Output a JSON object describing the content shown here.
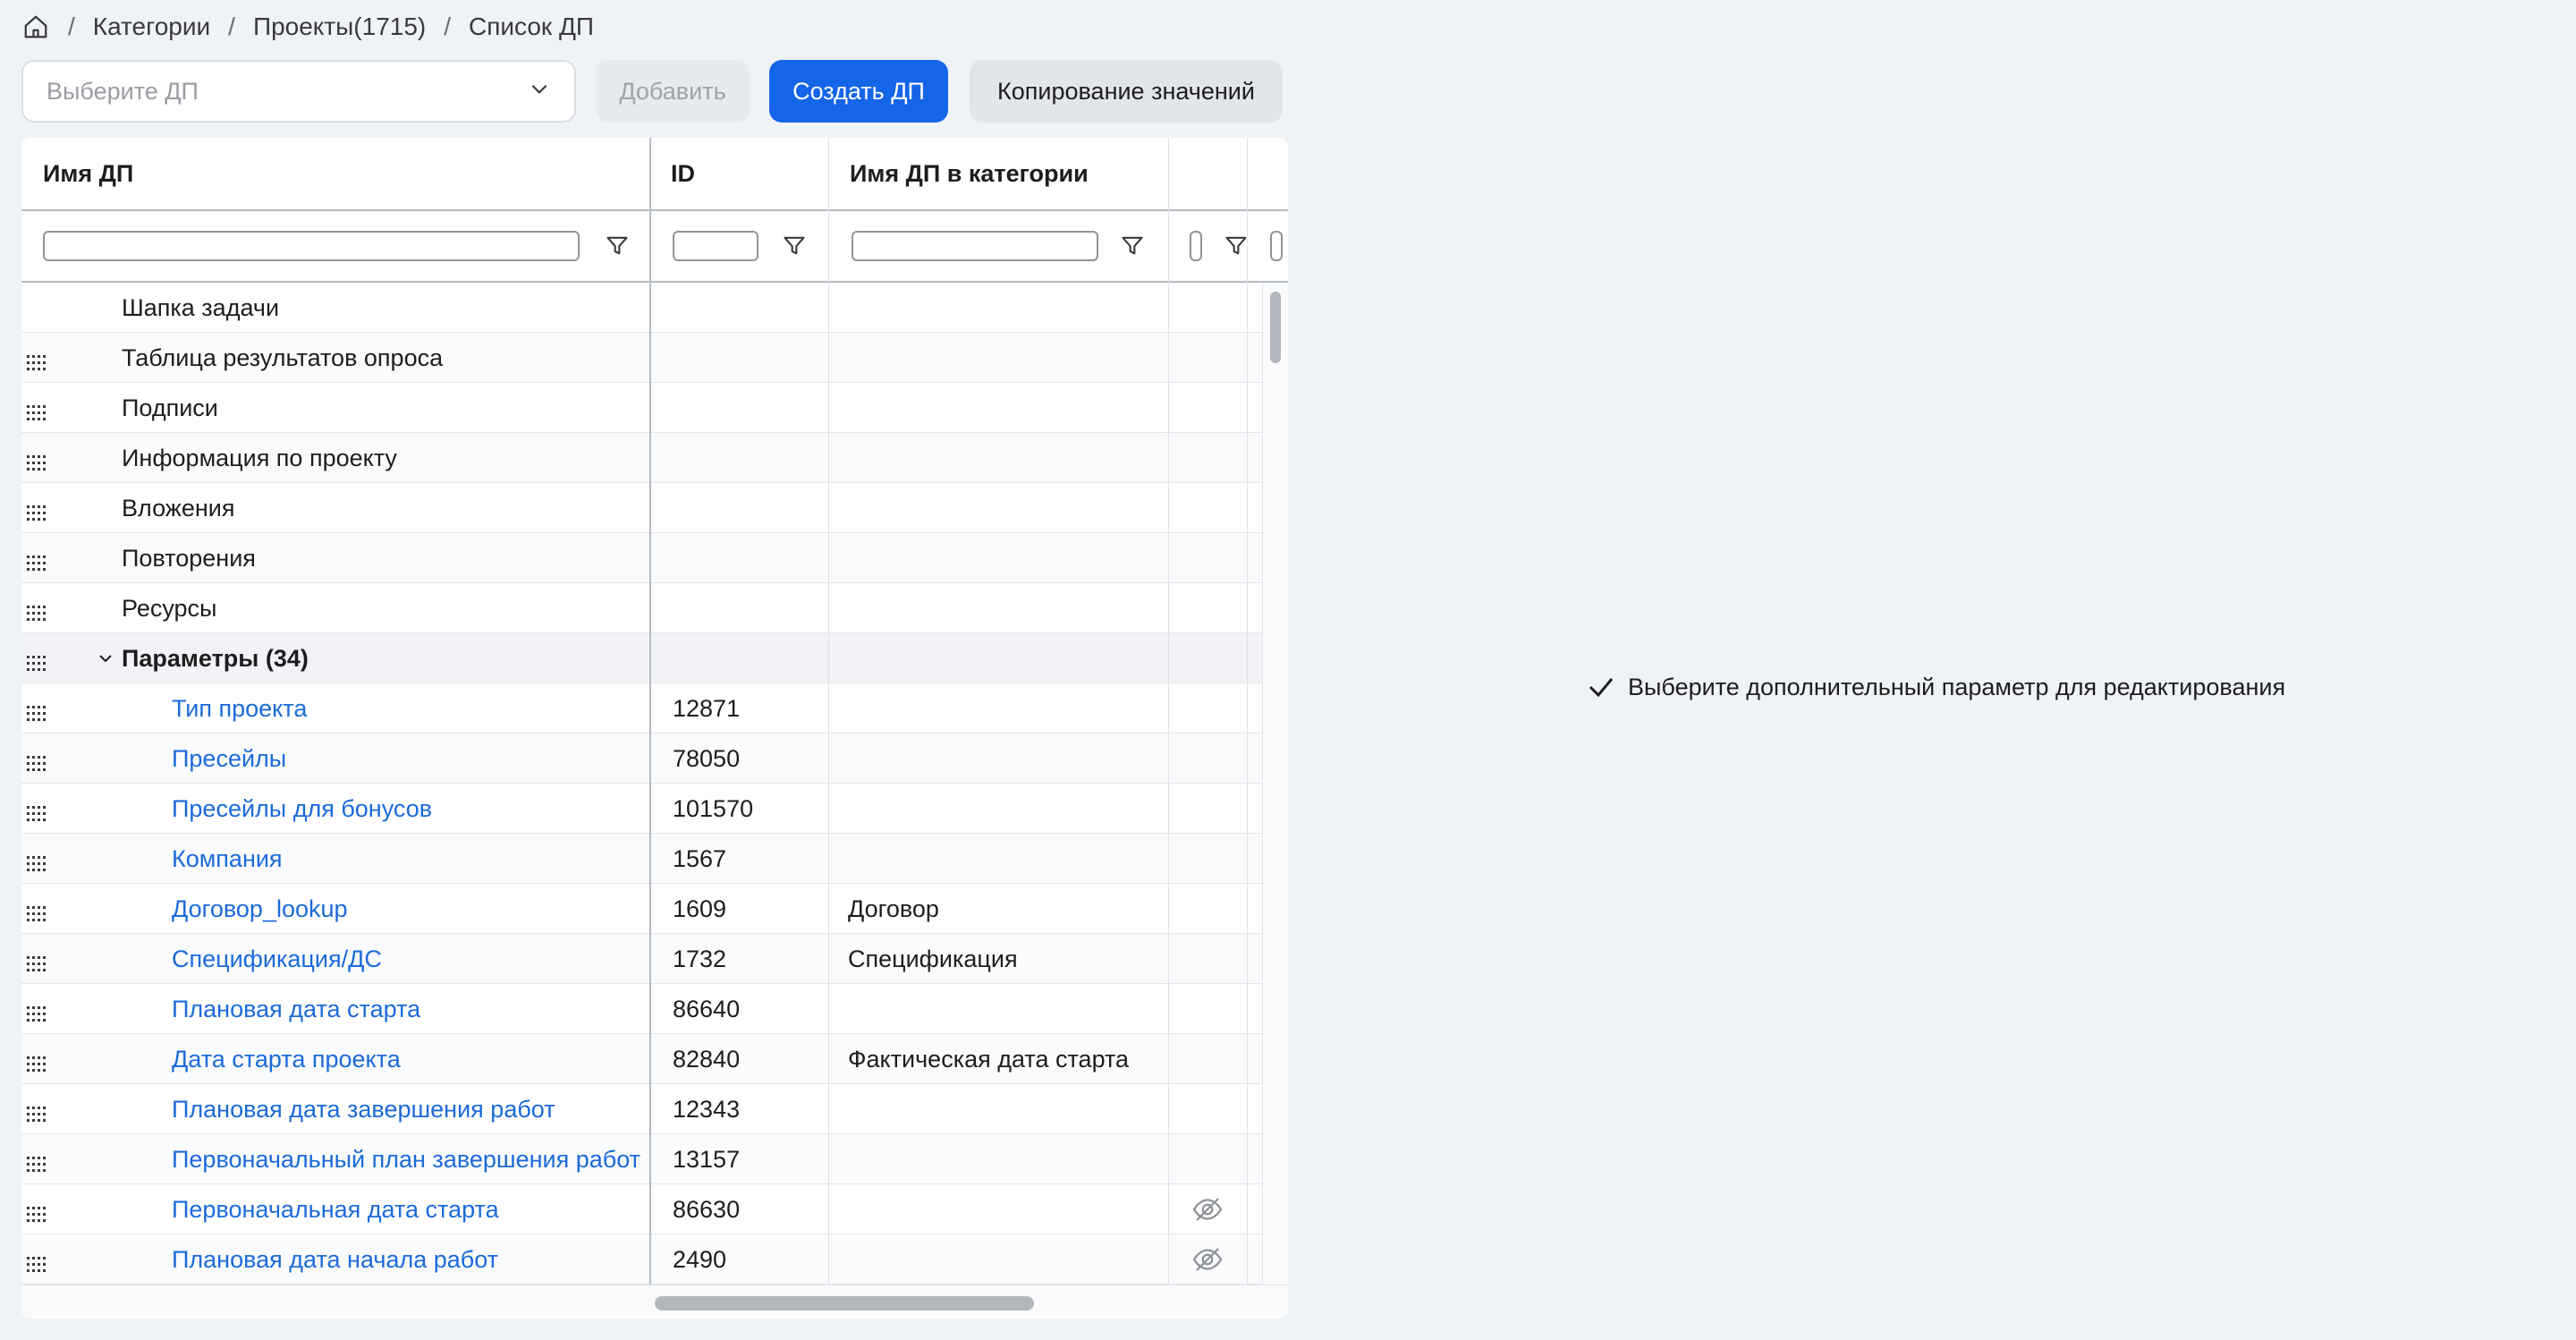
{
  "breadcrumb": {
    "home_icon": "home-icon",
    "items": [
      "Категории",
      "Проекты(1715)",
      "Список ДП"
    ],
    "separator": "/"
  },
  "toolbar": {
    "select_placeholder": "Выберите ДП",
    "add_label": "Добавить",
    "create_label": "Создать ДП",
    "copy_label": "Копирование значений",
    "primary_color": "#1565e8"
  },
  "table": {
    "columns": [
      "Имя ДП",
      "ID",
      "Имя ДП в категории",
      ""
    ],
    "rows": [
      {
        "name": "Шапка задачи",
        "id": "",
        "category_name": "",
        "drag": false,
        "level": 0
      },
      {
        "name": "Таблица результатов опроса",
        "id": "",
        "category_name": "",
        "drag": true,
        "level": 0
      },
      {
        "name": "Подписи",
        "id": "",
        "category_name": "",
        "drag": true,
        "level": 0
      },
      {
        "name": "Информация по проекту",
        "id": "",
        "category_name": "",
        "drag": true,
        "level": 0
      },
      {
        "name": "Вложения",
        "id": "",
        "category_name": "",
        "drag": true,
        "level": 0
      },
      {
        "name": "Повторения",
        "id": "",
        "category_name": "",
        "drag": true,
        "level": 0
      },
      {
        "name": "Ресурсы",
        "id": "",
        "category_name": "",
        "drag": true,
        "level": 0
      },
      {
        "name": "Параметры (34)",
        "id": "",
        "category_name": "",
        "drag": true,
        "level": 0,
        "group": true
      },
      {
        "name": "Тип проекта",
        "id": "12871",
        "category_name": "",
        "drag": true,
        "level": 1
      },
      {
        "name": "Пресейлы",
        "id": "78050",
        "category_name": "",
        "drag": true,
        "level": 1
      },
      {
        "name": "Пресейлы для бонусов",
        "id": "101570",
        "category_name": "",
        "drag": true,
        "level": 1
      },
      {
        "name": "Компания",
        "id": "1567",
        "category_name": "",
        "drag": true,
        "level": 1
      },
      {
        "name": "Договор_lookup",
        "id": "1609",
        "category_name": "Договор",
        "drag": true,
        "level": 1
      },
      {
        "name": "Спецификация/ДС",
        "id": "1732",
        "category_name": "Спецификация",
        "drag": true,
        "level": 1
      },
      {
        "name": "Плановая дата старта",
        "id": "86640",
        "category_name": "",
        "drag": true,
        "level": 1
      },
      {
        "name": "Дата старта проекта",
        "id": "82840",
        "category_name": "Фактическая дата старта",
        "drag": true,
        "level": 1
      },
      {
        "name": "Плановая дата завершения работ",
        "id": "12343",
        "category_name": "",
        "drag": true,
        "level": 1
      },
      {
        "name": "Первоначальный план завершения работ",
        "id": "13157",
        "category_name": "",
        "drag": true,
        "level": 1
      },
      {
        "name": "Первоначальная дата старта",
        "id": "86630",
        "category_name": "",
        "drag": true,
        "level": 1,
        "hidden_icon": "eye-off-icon"
      },
      {
        "name": "Плановая дата начала работ",
        "id": "2490",
        "category_name": "",
        "drag": true,
        "level": 1,
        "hidden_icon": "eye-off-icon"
      }
    ]
  },
  "message": {
    "icon": "check-icon",
    "text": "Выберите дополнительный параметр для редактирования"
  }
}
